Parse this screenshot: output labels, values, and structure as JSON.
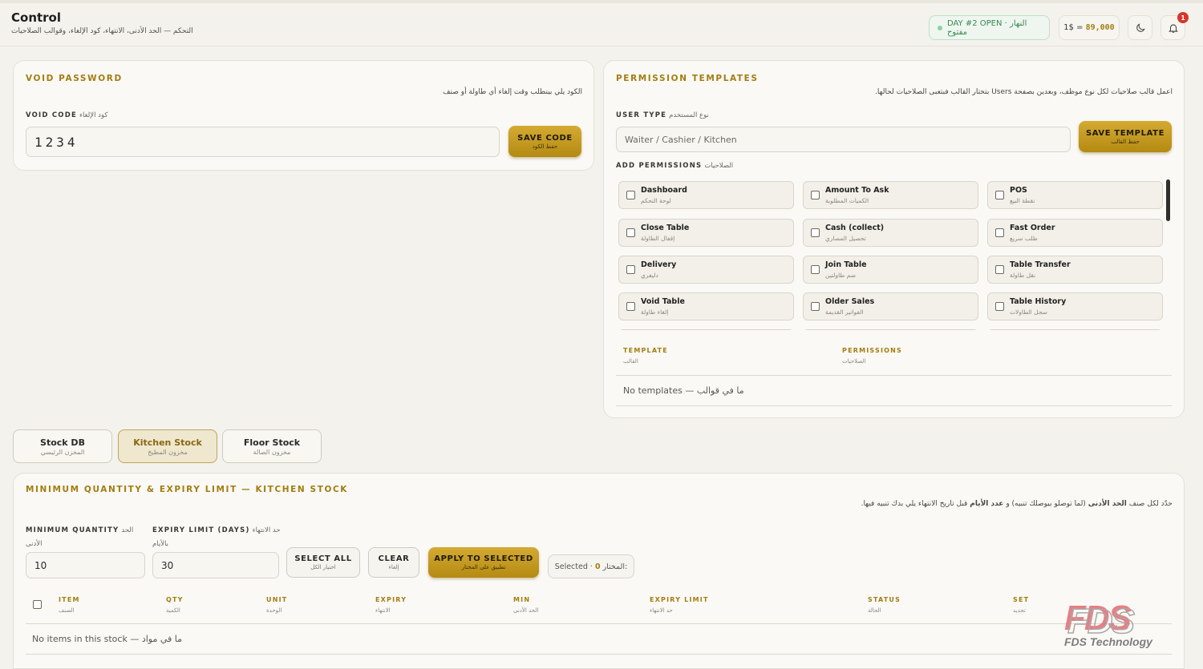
{
  "header": {
    "title": "Control",
    "subtitle": "التحكم — الحد الأدنى، الانتهاء، كود الإلغاء، وقوالب الصلاحيات",
    "day_status": "DAY #2 OPEN · النهار مفتوح",
    "rate_label": "1$ =",
    "rate_value": "89,000",
    "notification_count": "1"
  },
  "void_password": {
    "title": "VOID PASSWORD",
    "description": "الكود يلي بينطلب وقت إلغاء أي طاولة أو صنف",
    "label": "VOID CODE",
    "label_ar": "كود الإلغاء",
    "value": "1234",
    "save_label": "SAVE CODE",
    "save_label_ar": "حفظ الكود"
  },
  "permission_templates": {
    "title": "PERMISSION TEMPLATES",
    "description": "اعمل قالب صلاحيات لكل نوع موظف، وبعدين بصفحة Users بتختار القالب فبتعبى الصلاحيات لحالها.",
    "user_type_label": "USER TYPE",
    "user_type_label_ar": "نوع المستخدم",
    "user_type_placeholder": "Waiter / Cashier / Kitchen",
    "save_label": "SAVE TEMPLATE",
    "save_label_ar": "حفظ القالب",
    "add_permissions_label": "ADD PERMISSIONS",
    "add_permissions_label_ar": "الصلاحيات",
    "permissions": [
      {
        "en": "Dashboard",
        "ar": "لوحة التحكم"
      },
      {
        "en": "Amount To Ask",
        "ar": "الكميات المطلوبة"
      },
      {
        "en": "POS",
        "ar": "نقطة البيع"
      },
      {
        "en": "Close Table",
        "ar": "إقفال الطاولة"
      },
      {
        "en": "Cash (collect)",
        "ar": "تحصيل المصاري"
      },
      {
        "en": "Fast Order",
        "ar": "طلب سريع"
      },
      {
        "en": "Delivery",
        "ar": "دليفري"
      },
      {
        "en": "Join Table",
        "ar": "ضم طاولتين"
      },
      {
        "en": "Table Transfer",
        "ar": "نقل طاولة"
      },
      {
        "en": "Void Table",
        "ar": "إلغاء طاولة"
      },
      {
        "en": "Older Sales",
        "ar": "الفواتير القديمة"
      },
      {
        "en": "Table History",
        "ar": "سجل الطاولات"
      }
    ],
    "table_headers": [
      {
        "en": "TEMPLATE",
        "ar": "القالب"
      },
      {
        "en": "PERMISSIONS",
        "ar": "الصلاحيات"
      }
    ],
    "empty_text": "No templates — ما في قوالب"
  },
  "stock_tabs": [
    {
      "en": "Stock DB",
      "ar": "المخزن الرئيسي"
    },
    {
      "en": "Kitchen Stock",
      "ar": "مخزون المطبخ"
    },
    {
      "en": "Floor Stock",
      "ar": "مخزون الصالة"
    }
  ],
  "min_expiry": {
    "title": "MINIMUM QUANTITY & EXPIRY LIMIT — KITCHEN STOCK",
    "desc_prefix": "حدّد لكل صنف",
    "desc_bold1": "الحد الأدنى",
    "desc_mid": "(لما توصلو بيوصلك تنبيه) و",
    "desc_bold2": "عدد الأيام",
    "desc_suffix": "قبل تاريخ الانتهاء يلي بدك تنبيه فيها.",
    "min_qty_label": "MINIMUM QUANTITY",
    "min_qty_label_ar": "الحد الأدنى",
    "min_qty_value": "10",
    "expiry_label": "EXPIRY LIMIT (DAYS)",
    "expiry_label_ar": "حد الانتهاء بالأيام",
    "expiry_value": "30",
    "select_all": "SELECT ALL",
    "select_all_ar": "اختيار الكل",
    "clear": "CLEAR",
    "clear_ar": "إلغاء",
    "apply": "APPLY TO SELECTED",
    "apply_ar": "تطبيق على المختار",
    "selected_label": "Selected ·",
    "selected_count": "0",
    "selected_label_ar": "المختار:",
    "columns": [
      {
        "en": "ITEM",
        "ar": "الصنف"
      },
      {
        "en": "QTY",
        "ar": "الكمية"
      },
      {
        "en": "UNIT",
        "ar": "الوحدة"
      },
      {
        "en": "EXPIRY",
        "ar": "الانتهاء"
      },
      {
        "en": "MIN",
        "ar": "الحد الأدنى"
      },
      {
        "en": "EXPIRY LIMIT",
        "ar": "حد الانتهاء"
      },
      {
        "en": "STATUS",
        "ar": "الحالة"
      },
      {
        "en": "SET",
        "ar": "تحديد"
      }
    ],
    "empty_text": "No items in this stock — ما في مواد"
  },
  "watermark": {
    "logo": "FDS",
    "text": "FDS Technology"
  },
  "colors": {
    "accent_gold": "#b48a12",
    "title_gold": "#a37d12",
    "open_green": "#3a8a52",
    "badge_red": "#d8352b"
  }
}
